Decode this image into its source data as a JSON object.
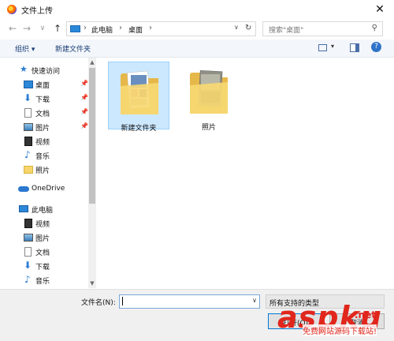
{
  "window": {
    "title": "文件上传",
    "close_symbol": "✕"
  },
  "address": {
    "crumbs": [
      "此电脑",
      "桌面"
    ],
    "search_placeholder": "搜索\"桌面\""
  },
  "toolbar": {
    "organize": "组织 ▾",
    "new_folder": "新建文件夹"
  },
  "nav": {
    "quick_access": "快速访问",
    "quick_items": [
      {
        "label": "桌面",
        "icon": "desktop-icon",
        "pinned": true
      },
      {
        "label": "下载",
        "icon": "download-icon",
        "pinned": true
      },
      {
        "label": "文档",
        "icon": "document-icon",
        "pinned": true
      },
      {
        "label": "图片",
        "icon": "pictures-icon",
        "pinned": true
      },
      {
        "label": "视频",
        "icon": "video-icon",
        "pinned": false
      },
      {
        "label": "音乐",
        "icon": "music-icon",
        "pinned": false
      },
      {
        "label": "照片",
        "icon": "folder-icon",
        "pinned": false
      }
    ],
    "onedrive": "OneDrive",
    "this_pc": "此电脑",
    "pc_items": [
      {
        "label": "视频",
        "icon": "video-icon"
      },
      {
        "label": "图片",
        "icon": "pictures-icon"
      },
      {
        "label": "文档",
        "icon": "document-icon"
      },
      {
        "label": "下载",
        "icon": "download-icon"
      },
      {
        "label": "音乐",
        "icon": "music-icon"
      }
    ]
  },
  "files": [
    {
      "name": "新建文件夹",
      "selected": true
    },
    {
      "name": "照片",
      "selected": false
    }
  ],
  "bottom": {
    "filename_label": "文件名(N):",
    "filename_value": "",
    "filetype": "所有支持的类型",
    "open": "打开(O)",
    "cancel": "取消"
  },
  "watermark": {
    "brand": "aspku",
    "tld": ".net",
    "tagline": "免费网站源码下载站!"
  }
}
